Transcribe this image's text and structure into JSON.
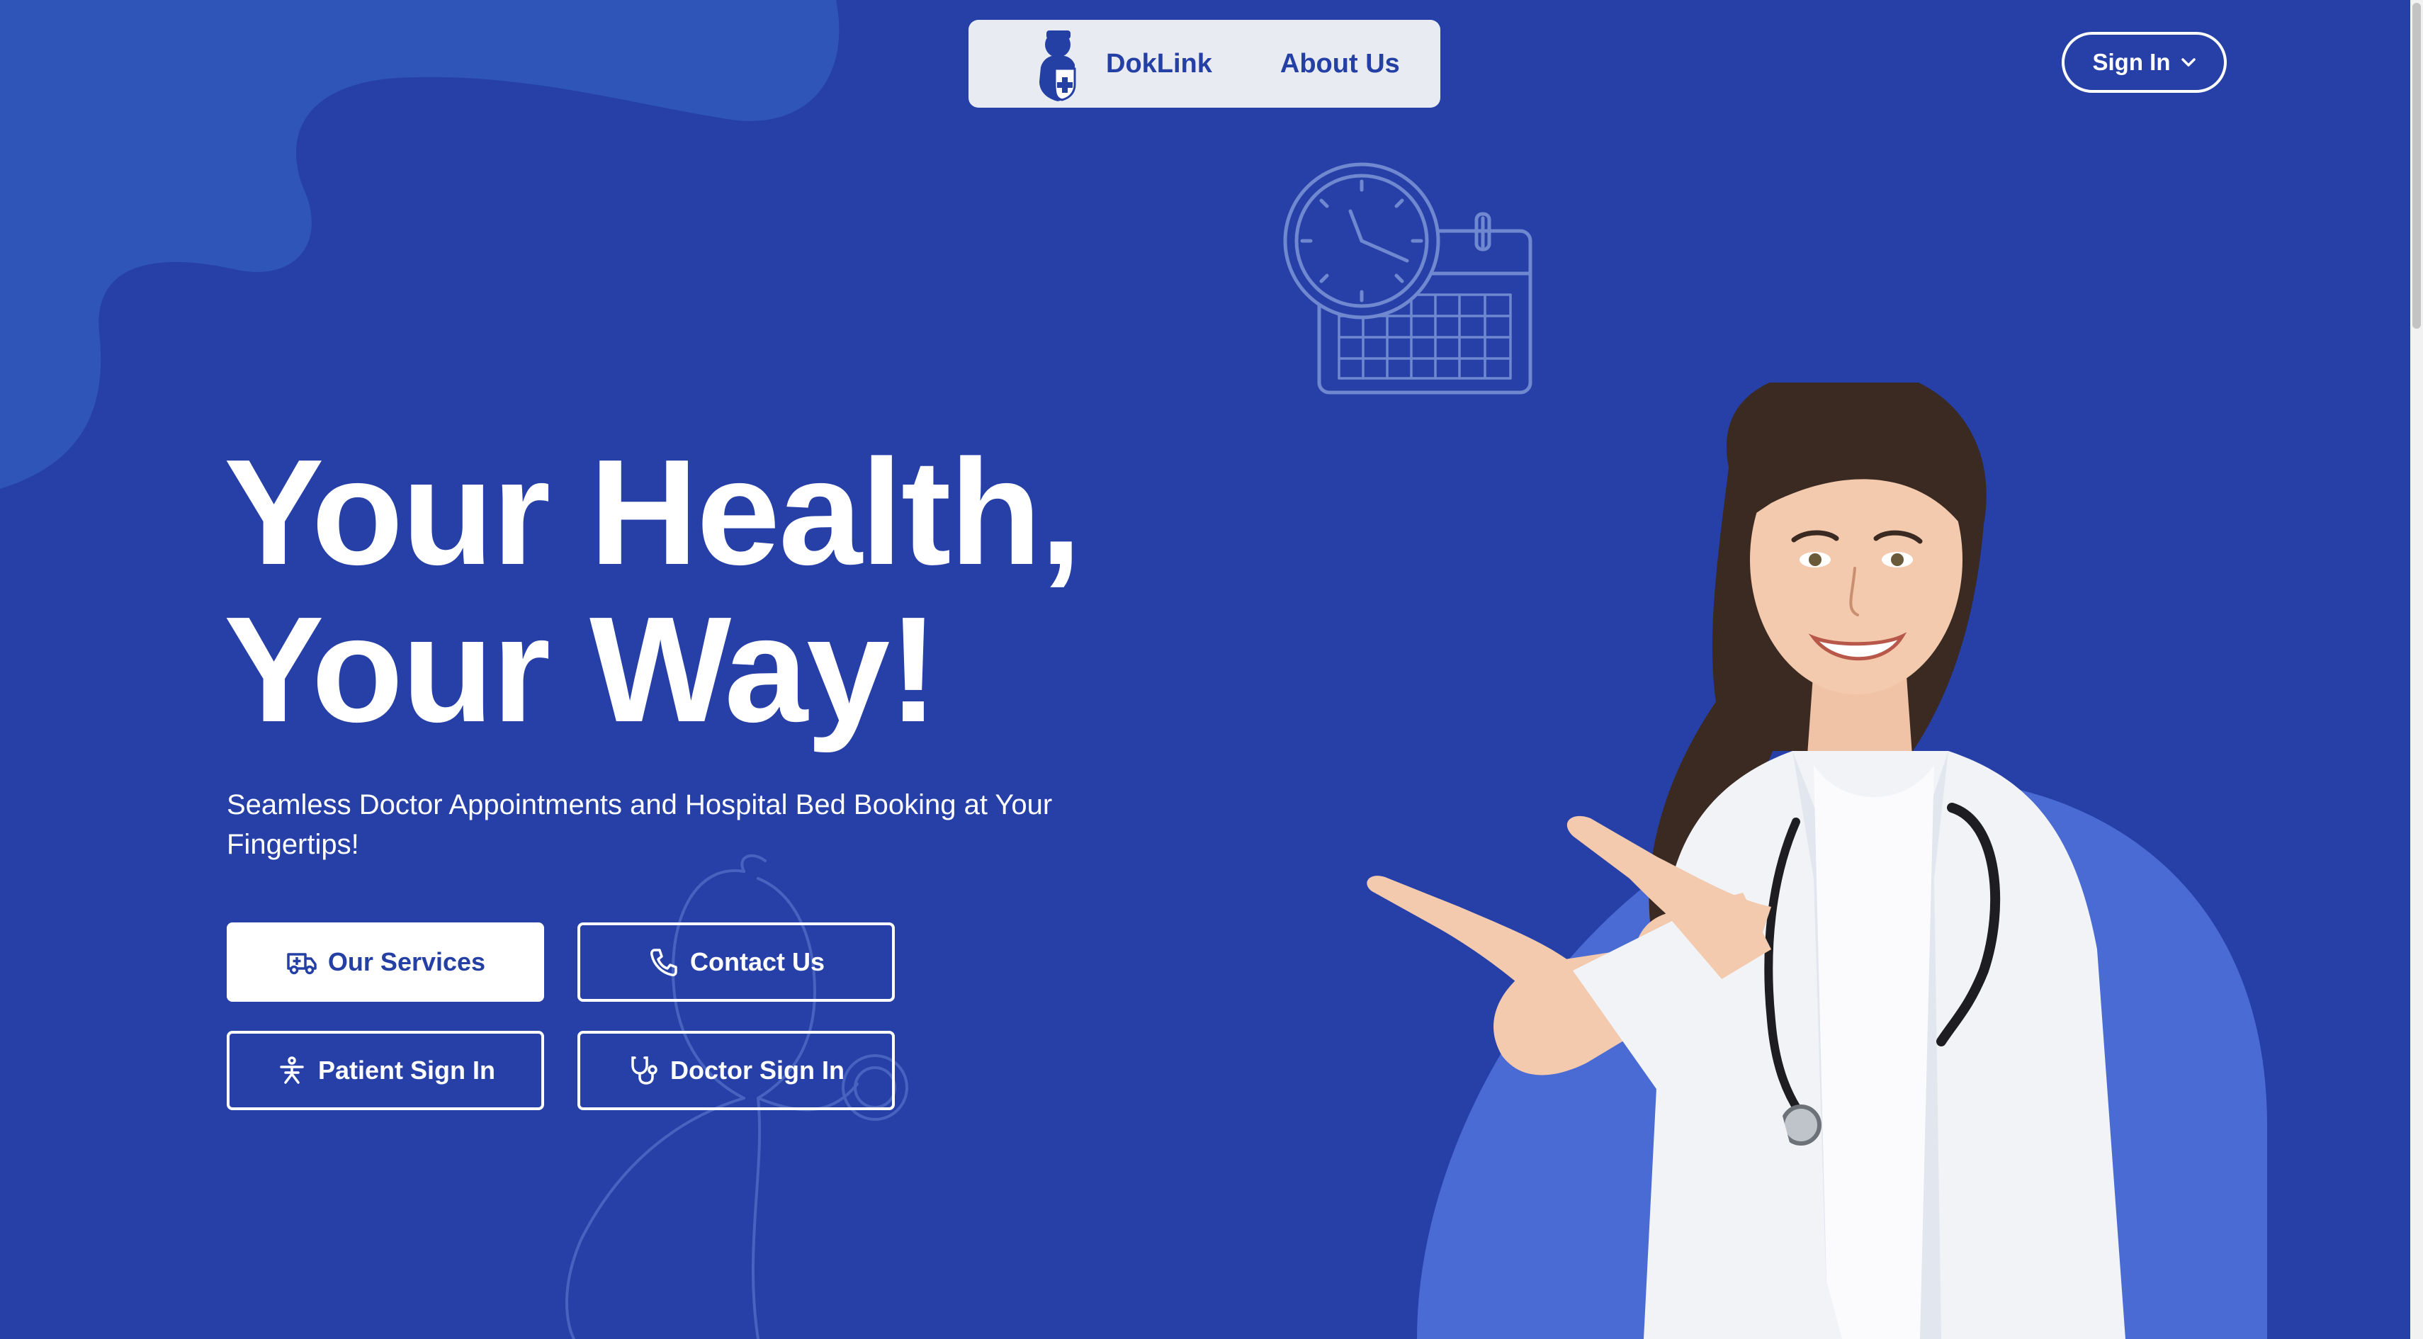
{
  "nav": {
    "brand": "DokLink",
    "about": "About Us",
    "sign_in": "Sign In"
  },
  "hero": {
    "title_line1": "Your Health,",
    "title_line2": "Your Way!",
    "subtitle": "Seamless Doctor Appointments and Hospital Bed Booking at Your Fingertips!"
  },
  "buttons": {
    "services": "Our Services",
    "contact": "Contact Us",
    "patient": "Patient Sign In",
    "doctor": "Doctor Sign In"
  },
  "colors": {
    "background": "#2640a8",
    "nav_pill": "#e9ebf2",
    "brand_text": "#2540a5",
    "white": "#ffffff"
  },
  "icons": {
    "logo": "doctor-shield-logo",
    "chevron": "chevron-down-icon",
    "services": "ambulance-icon",
    "contact": "phone-icon",
    "patient": "person-accessibility-icon",
    "doctor": "stethoscope-icon"
  }
}
